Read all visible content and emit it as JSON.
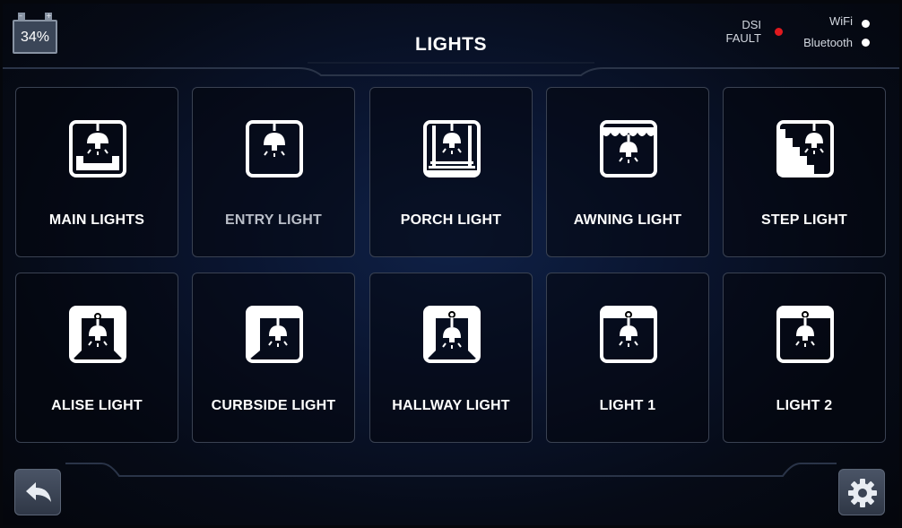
{
  "header": {
    "title": "LIGHTS",
    "battery": {
      "percent": "34%",
      "minus": "–",
      "plus": "+"
    },
    "dsi_fault": {
      "line1": "DSI",
      "line2": "FAULT",
      "color": "#e0191e"
    },
    "wifi": {
      "label": "WiFi",
      "color": "#ffffff"
    },
    "bluetooth": {
      "label": "Bluetooth",
      "color": "#ffffff"
    }
  },
  "tiles": [
    {
      "label": "MAIN LIGHTS",
      "icon": "main-lights-icon"
    },
    {
      "label": "ENTRY LIGHT",
      "icon": "entry-light-icon"
    },
    {
      "label": "PORCH LIGHT",
      "icon": "porch-light-icon"
    },
    {
      "label": "AWNING LIGHT",
      "icon": "awning-light-icon"
    },
    {
      "label": "STEP LIGHT",
      "icon": "step-light-icon"
    },
    {
      "label": "ALISE LIGHT",
      "icon": "aisle-light-icon"
    },
    {
      "label": "CURBSIDE LIGHT",
      "icon": "curbside-light-icon"
    },
    {
      "label": "HALLWAY LIGHT",
      "icon": "hallway-light-icon"
    },
    {
      "label": "LIGHT 1",
      "icon": "light-1-icon"
    },
    {
      "label": "LIGHT 2",
      "icon": "light-2-icon"
    }
  ],
  "footer": {
    "back_icon": "back-arrow-icon",
    "settings_icon": "gear-icon"
  },
  "colors": {
    "background": "#0a1530",
    "tile_border": "#3a4252",
    "button": "#3f4859"
  }
}
